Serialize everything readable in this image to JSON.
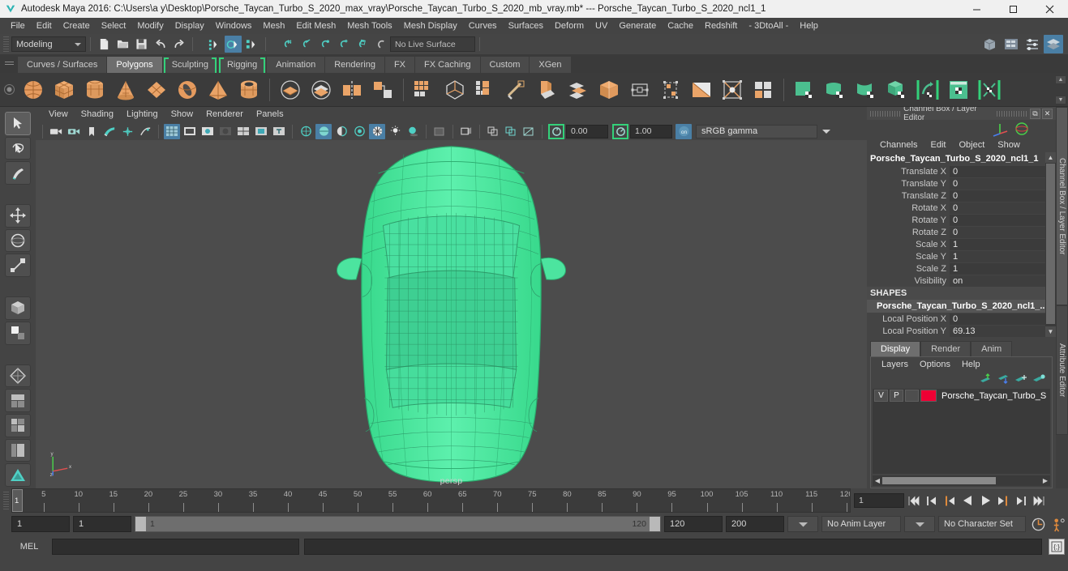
{
  "titlebar": {
    "app_title": "Autodesk Maya 2016: C:\\Users\\a y\\Desktop\\Porsche_Taycan_Turbo_S_2020_max_vray\\Porsche_Taycan_Turbo_S_2020_mb_vray.mb*  ---  Porsche_Taycan_Turbo_S_2020_ncl1_1",
    "minimize": "—",
    "maximize": "❐",
    "close": "✕"
  },
  "menubar": {
    "items": [
      "File",
      "Edit",
      "Create",
      "Select",
      "Modify",
      "Display",
      "Windows",
      "Mesh",
      "Edit Mesh",
      "Mesh Tools",
      "Mesh Display",
      "Curves",
      "Surfaces",
      "Deform",
      "UV",
      "Generate",
      "Cache",
      "Redshift",
      "- 3DtoAll -",
      "Help"
    ]
  },
  "statusline": {
    "menu_set": "Modeling",
    "live_surface": "No Live Surface",
    "icons": [
      "new-scene-icon",
      "open-scene-icon",
      "save-scene-icon",
      "undo-icon",
      "redo-icon",
      "select-by-hierarchy-icon",
      "select-by-object-icon",
      "select-by-component-icon",
      "snap-to-grid-icon",
      "snap-to-curve-icon",
      "snap-to-point-icon",
      "snap-to-projected-center-icon",
      "snap-to-view-plane-icon",
      "make-live-icon",
      "render-view-icon",
      "render-current-frame-icon",
      "ipr-render-icon",
      "render-settings-icon",
      "hypershade-icon"
    ],
    "right_icons": [
      "show-hide-modeling-toolkit-icon",
      "attribute-editor-icon",
      "tool-settings-icon",
      "channel-box-layer-editor-icon"
    ]
  },
  "shelf": {
    "tabs": [
      {
        "label": "Curves / Surfaces",
        "active": false,
        "bracket": false
      },
      {
        "label": "Polygons",
        "active": true,
        "bracket": false
      },
      {
        "label": "Sculpting",
        "active": false,
        "bracket": true
      },
      {
        "label": "Rigging",
        "active": false,
        "bracket": true
      },
      {
        "label": "Animation",
        "active": false,
        "bracket": false
      },
      {
        "label": "Rendering",
        "active": false,
        "bracket": false
      },
      {
        "label": "FX",
        "active": false,
        "bracket": false
      },
      {
        "label": "FX Caching",
        "active": false,
        "bracket": false
      },
      {
        "label": "Custom",
        "active": false,
        "bracket": false
      },
      {
        "label": "XGen",
        "active": false,
        "bracket": false
      }
    ],
    "icons": [
      "poly-sphere-icon",
      "poly-cube-icon",
      "poly-cylinder-icon",
      "poly-cone-icon",
      "poly-plane-icon",
      "poly-torus-icon",
      "poly-pyramid-icon",
      "poly-pipe-icon",
      "poly-boolean-union-icon",
      "poly-boolean-difference-icon",
      "poly-mirror-icon",
      "poly-combine-icon",
      "poly-smooth-icon",
      "poly-reduce-icon",
      "poly-extrude-icon",
      "poly-bevel-icon",
      "poly-bridge-icon",
      "poly-append-icon",
      "poly-wedge-icon",
      "poly-cut-icon",
      "poly-split-icon",
      "poly-crease-icon",
      "poly-transfer-attributes-icon",
      "poly-quad-draw-icon",
      "uv-texture-editor-icon",
      "uv-planar-map-icon",
      "uv-cylindrical-map-icon",
      "uv-automatic-map-icon",
      "uv-unfold-icon",
      "uv-layout-icon",
      "uv-optimize-icon"
    ]
  },
  "toolbox": {
    "items": [
      "select-tool-icon",
      "lasso-select-tool-icon",
      "paint-select-tool-icon",
      "move-tool-icon",
      "rotate-tool-icon",
      "scale-tool-icon",
      "last-tool-icon",
      "universal-manipulator-icon",
      "soft-modification-icon",
      "current-layout-icon",
      "persp-layout-icon",
      "four-view-layout-icon",
      "outliner-persp-layout-icon",
      "hypergraph-persp-layout-icon"
    ]
  },
  "viewport": {
    "menu": [
      "View",
      "Shading",
      "Lighting",
      "Show",
      "Renderer",
      "Panels"
    ],
    "toolbar_icons": [
      "select-camera-icon",
      "lock-camera-icon",
      "camera-attributes-icon",
      "bookmark-icon",
      "image-plane-icon",
      "two-sided-lighting-icon",
      "exposure-icon",
      "grid-toggle-icon",
      "film-gate-icon",
      "resolution-gate-icon",
      "gate-mask-icon",
      "field-chart-icon",
      "safe-action-icon",
      "safe-title-icon",
      "wireframe-icon",
      "smooth-shade-all-icon",
      "smooth-shade-selected-icon",
      "flat-shade-icon",
      "wireframe-on-shaded-icon",
      "texture-toggle-icon",
      "use-default-lighting-icon",
      "shadows-icon",
      "ambient-occlusion-icon",
      "motion-blur-icon",
      "isolate-select-icon",
      "xray-icon",
      "xray-joints-icon",
      "xray-active-components-icon"
    ],
    "exposure_value": "0.00",
    "gamma_value": "1.00",
    "color_space": "sRGB gamma",
    "camera_label": "persp",
    "axis": {
      "x_label": "x",
      "y_label": "y",
      "z_label": "z"
    },
    "wireframe_color": "#3ef09a",
    "background_color": "#4c4c4c"
  },
  "channel_box": {
    "panel_title": "Channel Box / Layer Editor",
    "menu": [
      "Channels",
      "Edit",
      "Object",
      "Show"
    ],
    "node_name": "Porsche_Taycan_Turbo_S_2020_ncl1_1",
    "attributes": [
      {
        "label": "Translate X",
        "value": "0"
      },
      {
        "label": "Translate Y",
        "value": "0"
      },
      {
        "label": "Translate Z",
        "value": "0"
      },
      {
        "label": "Rotate X",
        "value": "0"
      },
      {
        "label": "Rotate Y",
        "value": "0"
      },
      {
        "label": "Rotate Z",
        "value": "0"
      },
      {
        "label": "Scale X",
        "value": "1"
      },
      {
        "label": "Scale Y",
        "value": "1"
      },
      {
        "label": "Scale Z",
        "value": "1"
      },
      {
        "label": "Visibility",
        "value": "on"
      }
    ],
    "shapes_header": "SHAPES",
    "shape_name": "Porsche_Taycan_Turbo_S_2020_ncl1_...",
    "shape_attributes": [
      {
        "label": "Local Position X",
        "value": "0"
      },
      {
        "label": "Local Position Y",
        "value": "69.13"
      }
    ]
  },
  "layer_editor": {
    "tabs": [
      {
        "label": "Display",
        "active": true
      },
      {
        "label": "Render",
        "active": false
      },
      {
        "label": "Anim",
        "active": false
      }
    ],
    "menu": [
      "Layers",
      "Options",
      "Help"
    ],
    "toolbar_icons": [
      "move-layer-up-icon",
      "move-layer-down-icon",
      "new-layer-icon",
      "new-layer-from-selected-icon"
    ],
    "layers": [
      {
        "visibility": "V",
        "playback": "P",
        "shading": "",
        "color": "#ef0034",
        "name": "Porsche_Taycan_Turbo_S"
      }
    ]
  },
  "side_tabs": [
    {
      "label": "Channel Box / Layer Editor",
      "active": true
    },
    {
      "label": "Attribute Editor",
      "active": false
    }
  ],
  "timeline": {
    "start": 1,
    "end": 120,
    "tick_step": 5,
    "tick_labels": [
      5,
      10,
      15,
      20,
      25,
      30,
      35,
      40,
      45,
      50,
      55,
      60,
      65,
      70,
      75,
      80,
      85,
      90,
      95,
      100,
      105,
      110,
      115,
      120
    ],
    "current_frame": "1",
    "current_frame_field": "1",
    "playback_buttons": [
      "go-to-start-icon",
      "step-back-frame-icon",
      "step-back-key-icon",
      "play-backwards-icon",
      "play-forwards-icon",
      "step-forward-key-icon",
      "step-forward-frame-icon",
      "go-to-end-icon"
    ]
  },
  "range_slider": {
    "anim_start": "1",
    "playback_start": "1",
    "range_low": "1",
    "range_high": "120",
    "playback_end": "120",
    "anim_end": "200",
    "anim_layer": "No Anim Layer",
    "character_set": "No Character Set",
    "auto_key_icon": "auto-keyframe-icon",
    "anim_prefs_icon": "animation-preferences-icon"
  },
  "command_line": {
    "label": "MEL",
    "input_value": "",
    "output_value": "",
    "script_editor_icon": "script-editor-icon"
  }
}
